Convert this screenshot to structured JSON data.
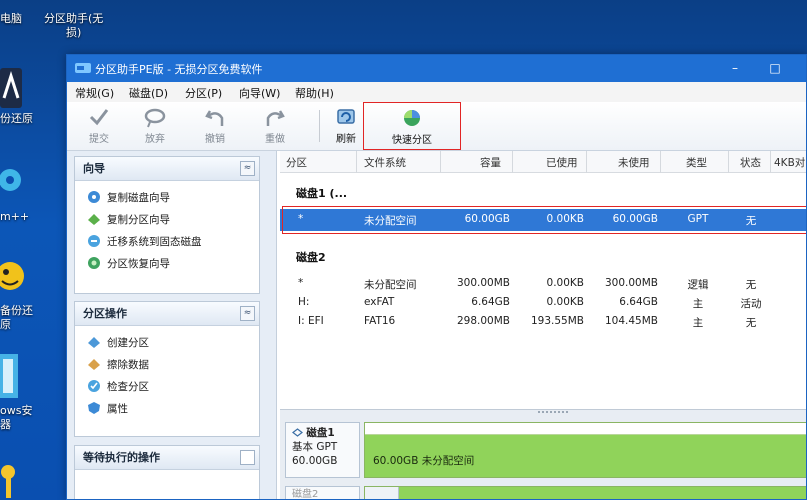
{
  "desktop": {
    "icons": [
      {
        "label": "电脑"
      },
      {
        "label_line1": "分区助手(无",
        "label_line2": "损)"
      },
      {
        "label": "份还原"
      },
      {
        "label": "m++"
      },
      {
        "label_line1": "备份还",
        "label_line2": "原"
      },
      {
        "label_line1": "ows安",
        "label_line2": "器"
      }
    ]
  },
  "window": {
    "title": "分区助手PE版 - 无损分区免费软件",
    "controls": {
      "minimize": "–",
      "maximize": "□"
    }
  },
  "menu": [
    "常规(G)",
    "磁盘(D)",
    "分区(P)",
    "向导(W)",
    "帮助(H)"
  ],
  "toolbar": {
    "buttons": [
      {
        "label": "提交",
        "icon": "check-icon"
      },
      {
        "label": "放弃",
        "icon": "discard-icon"
      },
      {
        "label": "撤销",
        "icon": "undo-icon"
      },
      {
        "label": "重做",
        "icon": "redo-icon"
      },
      {
        "label": "刷新",
        "icon": "refresh-icon"
      },
      {
        "label": "快速分区",
        "icon": "quick-partition-icon"
      }
    ]
  },
  "sidebar": {
    "wizard": {
      "title": "向导",
      "collapse": "≈",
      "items": [
        "复制磁盘向导",
        "复制分区向导",
        "迁移系统到固态磁盘",
        "分区恢复向导"
      ]
    },
    "partition_ops": {
      "title": "分区操作",
      "collapse": "≈",
      "items": [
        "创建分区",
        "擦除数据",
        "检查分区",
        "属性"
      ]
    },
    "pending": {
      "title": "等待执行的操作"
    }
  },
  "grid": {
    "columns": [
      "分区",
      "文件系统",
      "容量",
      "已使用",
      "未使用",
      "类型",
      "状态",
      "4KB对"
    ],
    "disks": [
      {
        "name": "磁盘1 (...",
        "rows": [
          {
            "partition": "*",
            "fs": "未分配空间",
            "capacity": "60.00GB",
            "used": "0.00KB",
            "unused": "60.00GB",
            "type": "GPT",
            "status": "无",
            "selected": true
          }
        ]
      },
      {
        "name": "磁盘2",
        "rows": [
          {
            "partition": "*",
            "fs": "未分配空间",
            "capacity": "300.00MB",
            "used": "0.00KB",
            "unused": "300.00MB",
            "type": "逻辑",
            "status": "无"
          },
          {
            "partition": "H:",
            "fs": "exFAT",
            "capacity": "6.64GB",
            "used": "0.00KB",
            "unused": "6.64GB",
            "type": "主",
            "status": "活动"
          },
          {
            "partition": "I: EFI",
            "fs": "FAT16",
            "capacity": "298.00MB",
            "used": "193.55MB",
            "unused": "104.45MB",
            "type": "主",
            "status": "无"
          }
        ]
      }
    ]
  },
  "disk_map": {
    "disk1": {
      "name": "磁盘1",
      "style": "基本 GPT",
      "size": "60.00GB",
      "bar_label": "60.00GB 未分配空间"
    },
    "disk2": {
      "name": "磁盘2"
    }
  },
  "colors": {
    "titlebar": "#1f6fd3",
    "selection": "#2f78d6",
    "highlight_border": "#e12525",
    "bar_green": "#90d35a"
  }
}
